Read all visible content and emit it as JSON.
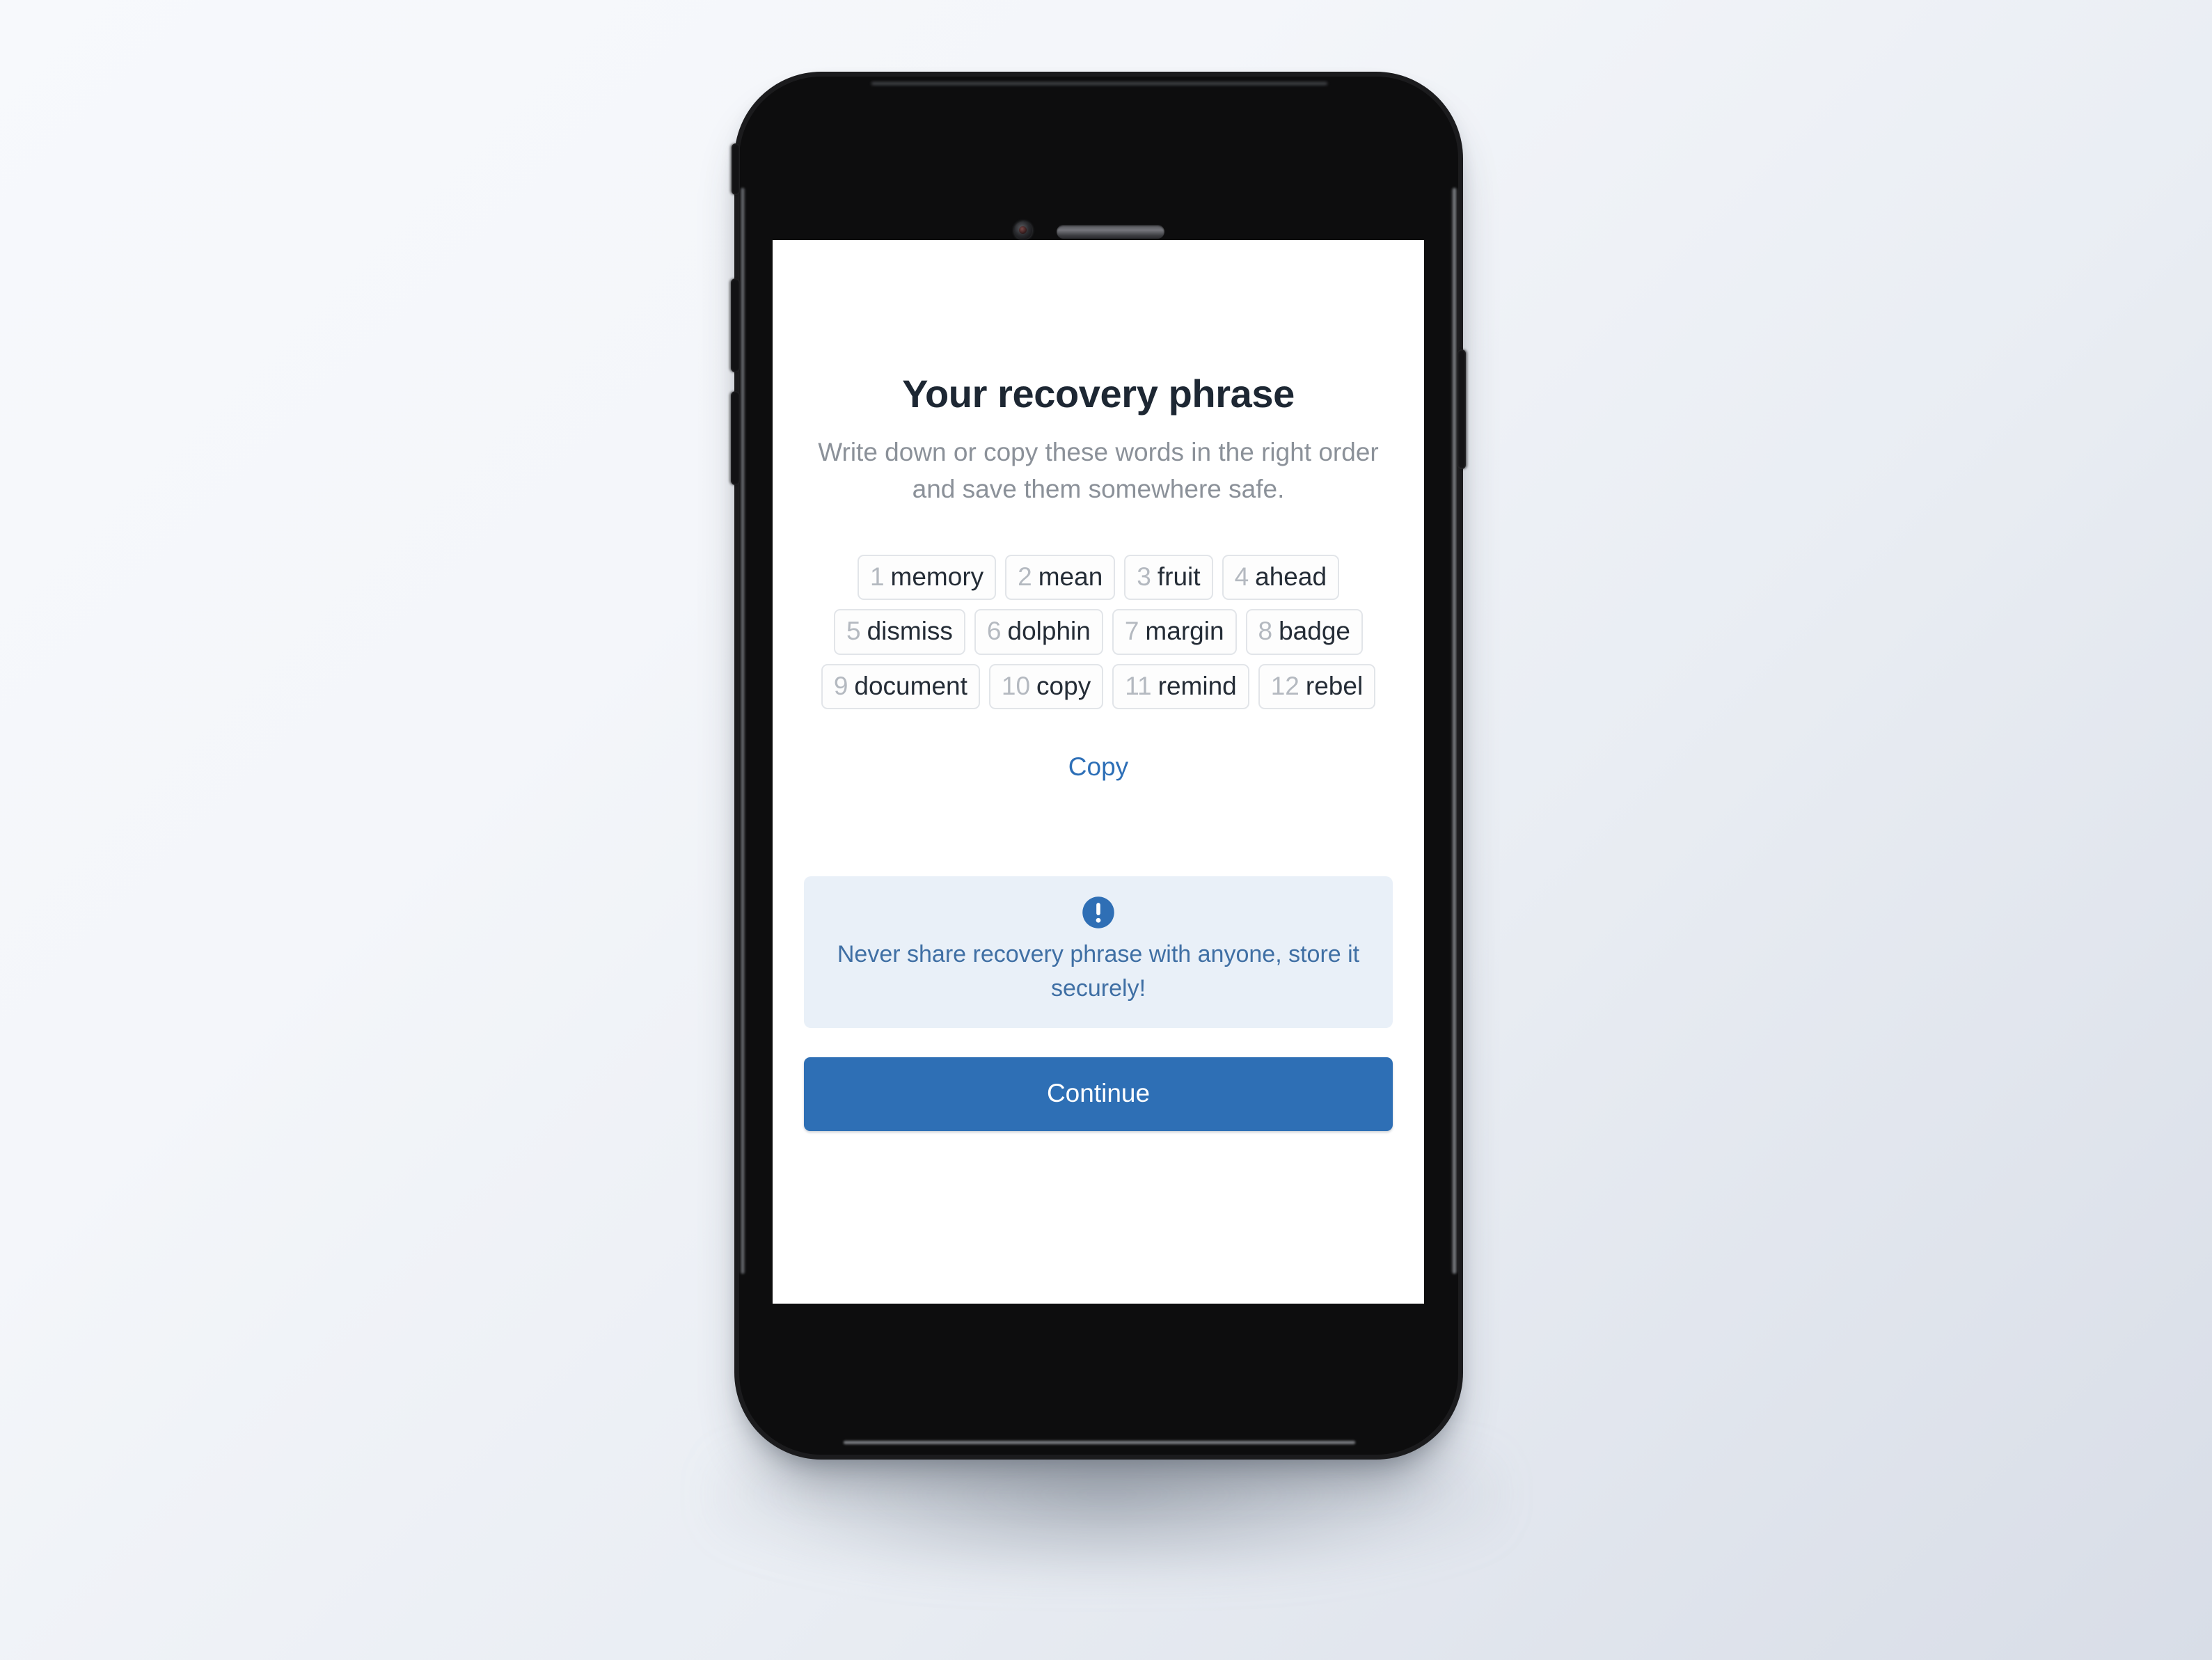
{
  "screen": {
    "title": "Your recovery phrase",
    "subtitle": "Write down or copy these words in the right order and save them somewhere safe.",
    "recovery_words": [
      {
        "index": "1",
        "word": "memory"
      },
      {
        "index": "2",
        "word": "mean"
      },
      {
        "index": "3",
        "word": "fruit"
      },
      {
        "index": "4",
        "word": "ahead"
      },
      {
        "index": "5",
        "word": "dismiss"
      },
      {
        "index": "6",
        "word": "dolphin"
      },
      {
        "index": "7",
        "word": "margin"
      },
      {
        "index": "8",
        "word": "badge"
      },
      {
        "index": "9",
        "word": "document"
      },
      {
        "index": "10",
        "word": "copy"
      },
      {
        "index": "11",
        "word": "remind"
      },
      {
        "index": "12",
        "word": "rebel"
      }
    ],
    "copy_link_label": "Copy",
    "warning": {
      "icon": "exclamation-circle-icon",
      "text": "Never share recovery phrase with anyone, store it securely!"
    },
    "continue_label": "Continue"
  },
  "device": {
    "hardware": {
      "camera": "front-camera",
      "speaker": "earpiece-speaker",
      "mute_switch": "mute-switch",
      "volume_up": "volume-up-button",
      "volume_down": "volume-down-button",
      "power": "power-button"
    }
  },
  "colors": {
    "accent_blue": "#2e6fb5",
    "link_blue": "#2d6fb7",
    "warning_bg": "#e9f0f8",
    "warning_text": "#3f6fa4",
    "title_text": "#1d2733",
    "subtitle_text": "#8b9199",
    "chip_border": "#e2e5e9",
    "chip_number": "#b4b9c0",
    "chip_word": "#242c36",
    "device_body": "#0d0d0e",
    "screen_bg": "#ffffff"
  }
}
